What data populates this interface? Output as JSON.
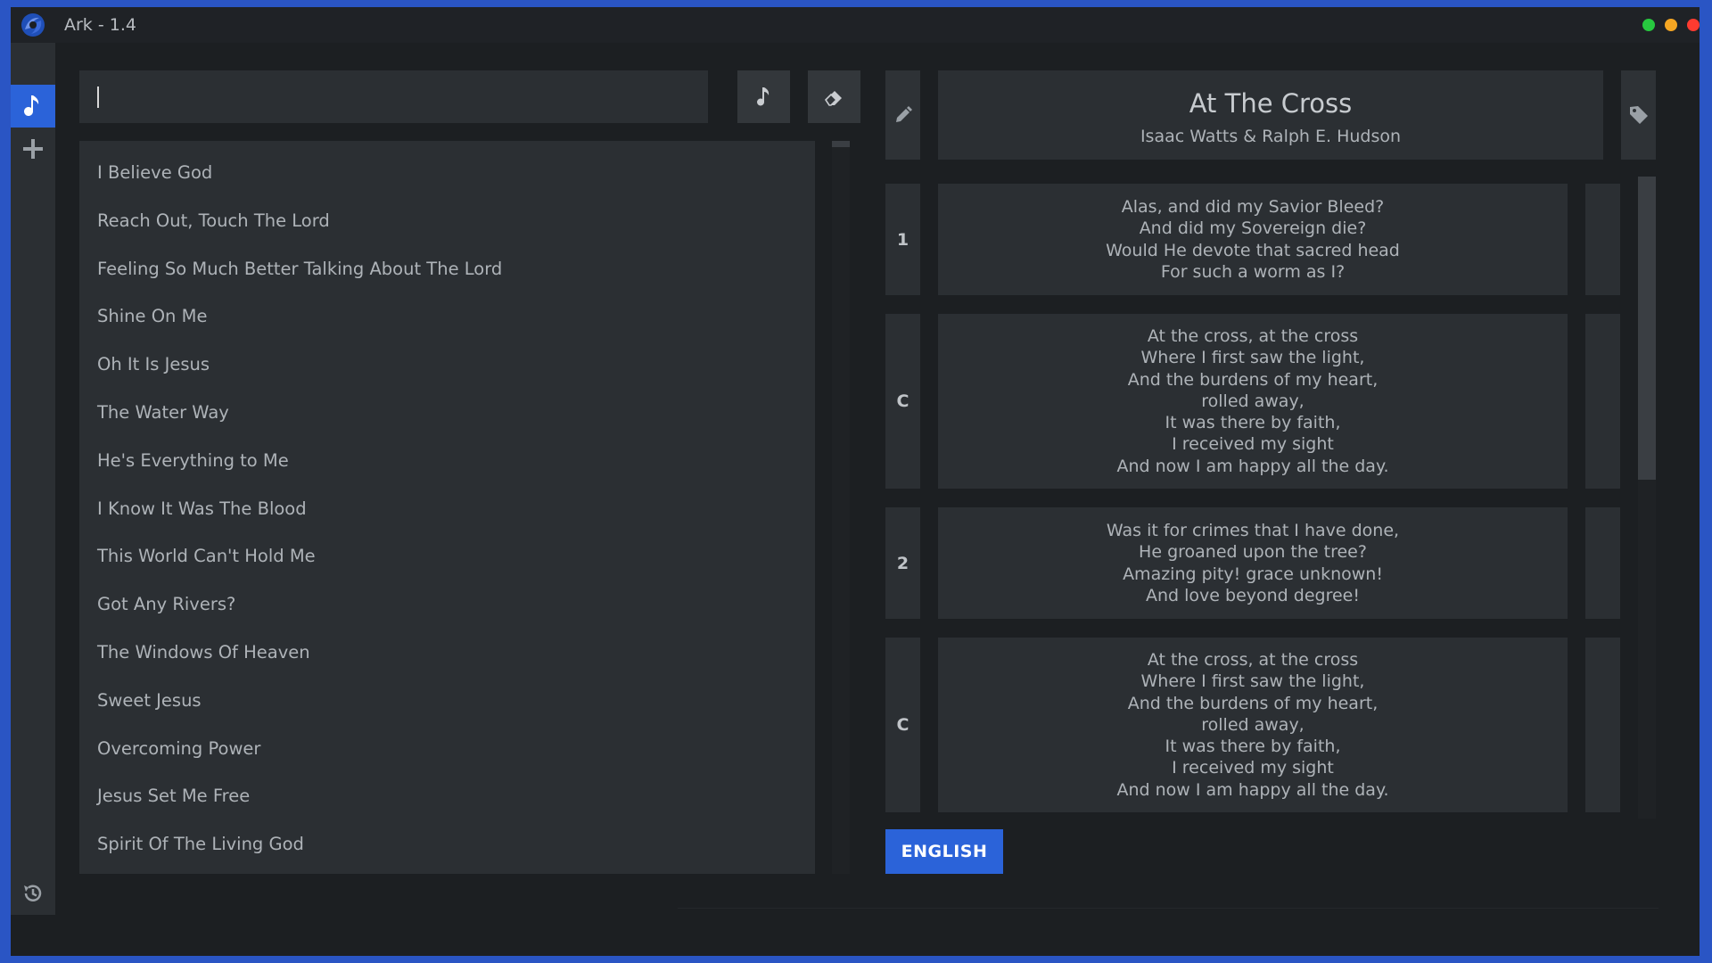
{
  "window": {
    "title": "Ark - 1.4",
    "controls": [
      {
        "name": "maximize",
        "color": "#27c93f"
      },
      {
        "name": "minimize",
        "color": "#f5a623"
      },
      {
        "name": "close",
        "color": "#ff3b30"
      }
    ]
  },
  "colors": {
    "accent": "#2b63d9",
    "background": "#1c1f22",
    "panel": "#2b2f33",
    "frame": "#2a55c4"
  },
  "sidebar": {
    "items": [
      {
        "icon": "music-note-icon",
        "active": true
      },
      {
        "icon": "plus-icon",
        "active": false
      }
    ],
    "bottom_icon": "history-icon"
  },
  "search": {
    "value": "",
    "placeholder": "",
    "song_button_icon": "music-note-icon",
    "clear_button_icon": "eraser-icon"
  },
  "songs": [
    "I Believe God",
    "Reach Out, Touch The Lord",
    "Feeling So Much Better Talking About The Lord",
    "Shine On Me",
    "Oh It Is Jesus",
    "The Water Way",
    "He's Everything to Me",
    "I Know It Was The Blood",
    "This World Can't Hold Me",
    "Got Any Rivers?",
    "The Windows Of Heaven",
    "Sweet Jesus",
    "Overcoming Power",
    "Jesus Set Me Free",
    "Spirit Of The Living God"
  ],
  "song": {
    "title": "At The Cross",
    "author": "Isaac Watts & Ralph E. Hudson",
    "edit_icon": "pencil-icon",
    "tag_icon": "tag-icon",
    "verses": [
      {
        "label": "1",
        "lines": [
          "Alas, and did my Savior Bleed?",
          "And did my Sovereign die?",
          "Would He devote that sacred head",
          "For such a worm as I?"
        ]
      },
      {
        "label": "C",
        "lines": [
          "At the cross, at the cross",
          "Where I first saw the light,",
          "And the burdens of my heart,",
          "rolled away,",
          "It was there by faith,",
          "I received my sight",
          "And now I am happy all the day."
        ]
      },
      {
        "label": "2",
        "lines": [
          "Was it for crimes that I have done,",
          "He groaned upon the tree?",
          "Amazing pity! grace unknown!",
          "And love beyond degree!"
        ]
      },
      {
        "label": "C",
        "lines": [
          "At the cross, at the cross",
          "Where I first saw the light,",
          "And the burdens of my heart,",
          "rolled away,",
          "It was there by faith,",
          "I received my sight",
          "And now I am happy all the day."
        ]
      }
    ]
  },
  "language_button": "ENGLISH"
}
